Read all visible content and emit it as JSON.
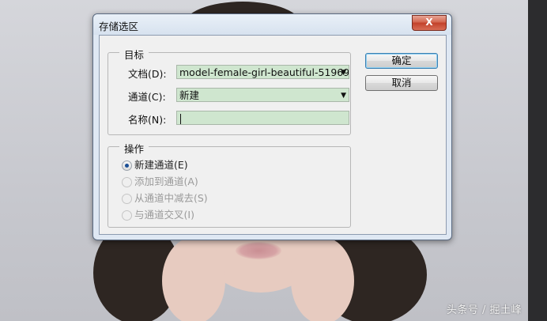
{
  "dialog": {
    "title": "存储选区",
    "close_glyph": "X",
    "target_group": {
      "label": "目标",
      "document_label": "文档(D):",
      "document_value": "model-female-girl-beautiful-51969...",
      "channel_label": "通道(C):",
      "channel_value": "新建",
      "name_label": "名称(N):",
      "name_value": ""
    },
    "operation_group": {
      "label": "操作",
      "options": [
        {
          "label": "新建通道(E)",
          "checked": true,
          "enabled": true
        },
        {
          "label": "添加到通道(A)",
          "checked": false,
          "enabled": false
        },
        {
          "label": "从通道中减去(S)",
          "checked": false,
          "enabled": false
        },
        {
          "label": "与通道交叉(I)",
          "checked": false,
          "enabled": false
        }
      ]
    },
    "buttons": {
      "ok_label": "确定",
      "cancel_label": "取消"
    }
  },
  "watermark": "头条号 / 掘土峰",
  "colors": {
    "field_bg": "#cfe6cf",
    "radio_checked": "#1b4f96",
    "close_button": "#c2412a"
  }
}
